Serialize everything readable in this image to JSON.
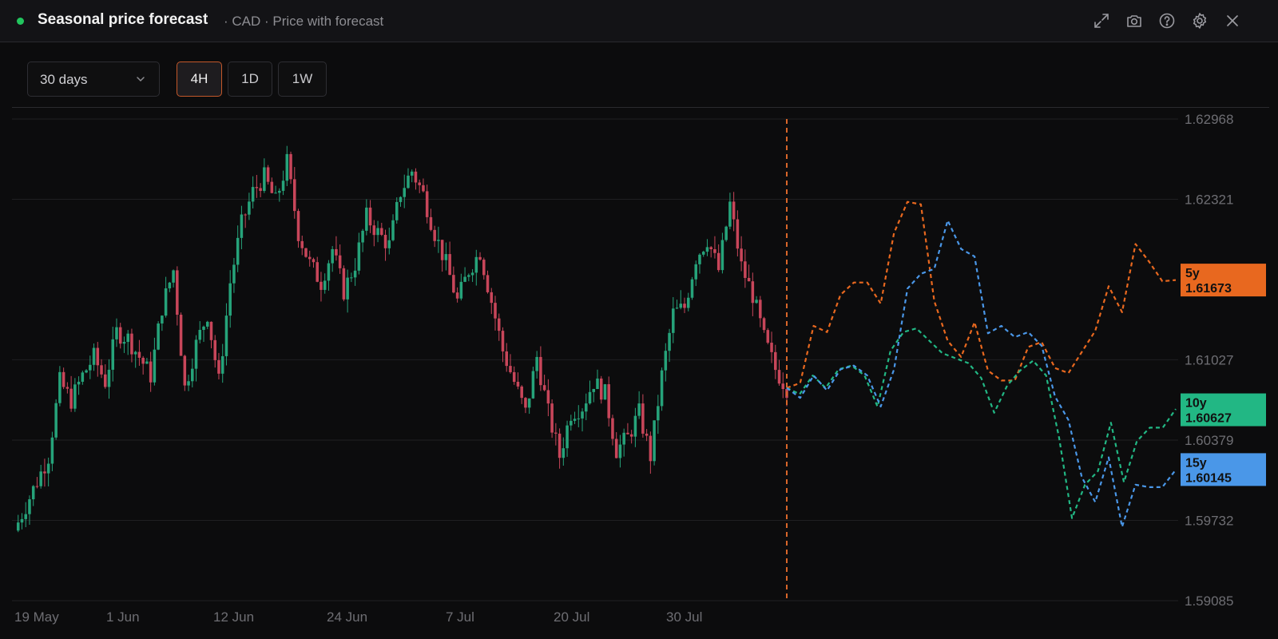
{
  "header": {
    "title": "Seasonal price forecast",
    "subtitle": "· CAD · Price with forecast",
    "status_color": "#22c55e",
    "icons": [
      "expand-icon",
      "camera-icon",
      "help-icon",
      "gear-icon",
      "close-icon"
    ]
  },
  "controls": {
    "range_value": "30 days",
    "timeframes": [
      "4H",
      "1D",
      "1W"
    ],
    "active_timeframe": "4H"
  },
  "colors": {
    "up": "#26a37a",
    "down": "#c8465a",
    "5y": "#e8681f",
    "10y": "#22b784",
    "15y": "#4a97e8",
    "now_line": "#d9662a"
  },
  "chart_data": {
    "type": "line",
    "subtype": "candlestick-with-forecast",
    "ylim": [
      1.59085,
      1.62968
    ],
    "yticks": [
      "1.62968",
      "1.62321",
      "1.61027",
      "1.60379",
      "1.59732",
      "1.59085"
    ],
    "x_tick_labels": [
      "19 May",
      "1 Jun",
      "12 Jun",
      "24 Jun",
      "7 Jul",
      "20 Jul",
      "30 Jul"
    ],
    "history_close": [
      1.5965,
      1.5985,
      1.6005,
      1.6025,
      1.6085,
      1.607,
      1.609,
      1.6105,
      1.6085,
      1.6125,
      1.612,
      1.6105,
      1.609,
      1.6145,
      1.6175,
      1.608,
      1.6115,
      1.614,
      1.6085,
      1.6165,
      1.6212,
      1.6238,
      1.625,
      1.623,
      1.6262,
      1.6205,
      1.618,
      1.6165,
      1.6192,
      1.6158,
      1.618,
      1.6218,
      1.6205,
      1.6195,
      1.6238,
      1.6255,
      1.6236,
      1.6205,
      1.618,
      1.615,
      1.6175,
      1.619,
      1.615,
      1.611,
      1.6085,
      1.606,
      1.6105,
      1.606,
      1.6025,
      1.606,
      1.6065,
      1.6085,
      1.6075,
      1.603,
      1.604,
      1.606,
      1.6025,
      1.609,
      1.614,
      1.6145,
      1.6185,
      1.62,
      1.6175,
      1.6228,
      1.6178,
      1.6155,
      1.612,
      1.6095,
      1.608
    ],
    "forecast_points": 20,
    "series": [
      {
        "name": "5y",
        "label": "1.61673",
        "values": [
          1.608,
          1.6084,
          1.613,
          1.6125,
          1.6155,
          1.6165,
          1.6165,
          1.6148,
          1.6205,
          1.623,
          1.6228,
          1.615,
          1.6118,
          1.6105,
          1.6133,
          1.6094,
          1.6086,
          1.6086,
          1.6113,
          1.6117,
          1.6096,
          1.6092,
          1.6109,
          1.6126,
          1.6162,
          1.6141,
          1.6196,
          1.6182,
          1.6166,
          1.6167
        ]
      },
      {
        "name": "10y",
        "label": "1.60627",
        "values": [
          1.608,
          1.6075,
          1.609,
          1.608,
          1.6095,
          1.6098,
          1.609,
          1.6065,
          1.611,
          1.6125,
          1.6128,
          1.6118,
          1.6108,
          1.6104,
          1.61,
          1.6088,
          1.606,
          1.6082,
          1.6094,
          1.6102,
          1.609,
          1.604,
          1.5975,
          1.6002,
          1.6013,
          1.6052,
          1.6004,
          1.6037,
          1.6048,
          1.6048,
          1.6063
        ]
      },
      {
        "name": "15y",
        "label": "1.60145",
        "values": [
          1.608,
          1.6072,
          1.609,
          1.6078,
          1.6095,
          1.6098,
          1.609,
          1.6065,
          1.6095,
          1.616,
          1.6172,
          1.6176,
          1.6215,
          1.6192,
          1.6186,
          1.6124,
          1.613,
          1.6121,
          1.6125,
          1.6114,
          1.6073,
          1.6054,
          1.6008,
          1.5988,
          1.6024,
          1.5968,
          1.6002,
          1.6,
          1.6,
          1.6014
        ]
      }
    ]
  }
}
